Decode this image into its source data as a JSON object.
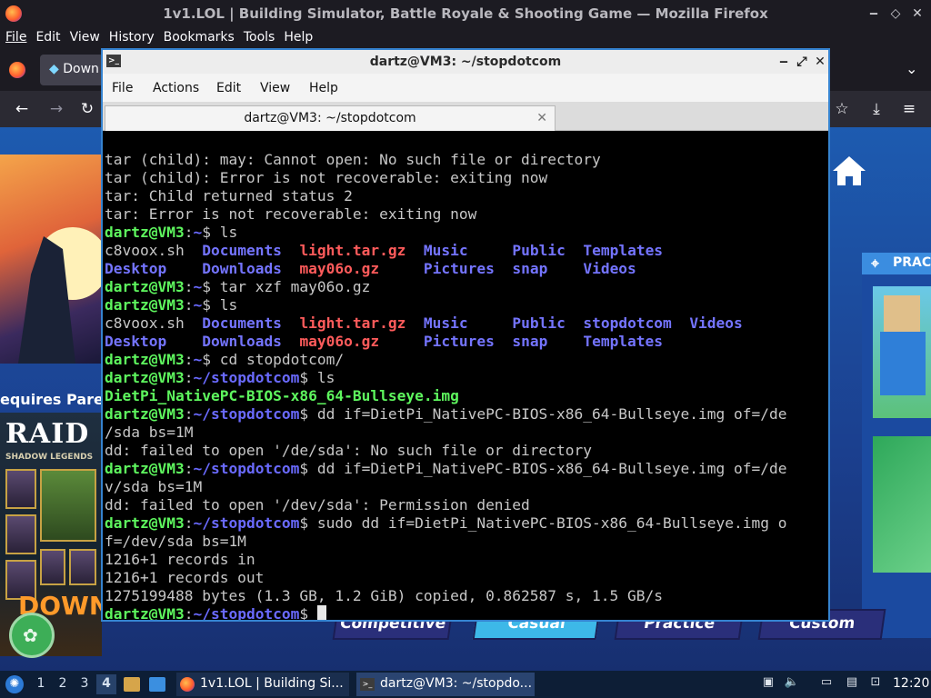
{
  "firefox": {
    "window_title": "1v1.LOL | Building Simulator, Battle Royale & Shooting Game — Mozilla Firefox",
    "menu": [
      "File",
      "Edit",
      "View",
      "History",
      "Bookmarks",
      "Tools",
      "Help"
    ],
    "tab_partial_label": "Down"
  },
  "page": {
    "requires_text": "equires Pare",
    "ad_raid_title": "RAID",
    "ad_raid_subtitle": "SHADOW LEGENDS",
    "ad_download": "DOWNL",
    "practice_label": "PRAC",
    "modes": [
      "Competitive",
      "Casual",
      "Practice",
      "Custom"
    ]
  },
  "terminal": {
    "window_title": "dartz@VM3: ~/stopdotcom",
    "menu": [
      "File",
      "Actions",
      "Edit",
      "View",
      "Help"
    ],
    "tab_title": "dartz@VM3: ~/stopdotcom",
    "prompt_user": "dartz@VM3",
    "lines": {
      "l1": "tar (child): may: Cannot open: No such file or directory",
      "l2": "tar (child): Error is not recoverable: exiting now",
      "l3": "tar: Child returned status 2",
      "l4": "tar: Error is not recoverable: exiting now",
      "cmd_ls1": "$ ls",
      "ls1_r1": [
        "c8voox.sh",
        "Documents",
        "light.tar.gz",
        "Music",
        "Public",
        "Templates"
      ],
      "ls1_r2": [
        "Desktop",
        "Downloads",
        "may06o.gz",
        "Pictures",
        "snap",
        "Videos"
      ],
      "cmd_tar": "$ tar xzf may06o.gz",
      "cmd_ls2": "$ ls",
      "ls2_r1": [
        "c8voox.sh",
        "Documents",
        "light.tar.gz",
        "Music",
        "Public",
        "stopdotcom",
        "Videos"
      ],
      "ls2_r2": [
        "Desktop",
        "Downloads",
        "may06o.gz",
        "Pictures",
        "snap",
        "Templates"
      ],
      "cmd_cd": "$ cd stopdotcom/",
      "cwd": "~/stopdotcom",
      "cwd_home": "~",
      "cmd_ls3": "$ ls",
      "ls3": "DietPi_NativePC-BIOS-x86_64-Bullseye.img",
      "cmd_dd1a": "$ dd if=DietPi_NativePC-BIOS-x86_64-Bullseye.img of=/de",
      "cmd_dd1b": "/sda bs=1M",
      "err1": "dd: failed to open '/de/sda': No such file or directory",
      "cmd_dd2a": "$ dd if=DietPi_NativePC-BIOS-x86_64-Bullseye.img of=/de",
      "cmd_dd2b": "v/sda bs=1M",
      "err2": "dd: failed to open '/dev/sda': Permission denied",
      "cmd_dd3a": "$ sudo dd if=DietPi_NativePC-BIOS-x86_64-Bullseye.img o",
      "cmd_dd3b": "f=/dev/sda bs=1M",
      "rec_in": "1216+1 records in",
      "rec_out": "1216+1 records out",
      "copied": "1275199488 bytes (1.3 GB, 1.2 GiB) copied, 0.862587 s, 1.5 GB/s",
      "final": "$ "
    }
  },
  "taskbar": {
    "workspaces": [
      "1",
      "2",
      "3",
      "4"
    ],
    "task_firefox": "1v1.LOL | Building Si...",
    "task_terminal": "dartz@VM3: ~/stopdo...",
    "clock": "12:20"
  }
}
